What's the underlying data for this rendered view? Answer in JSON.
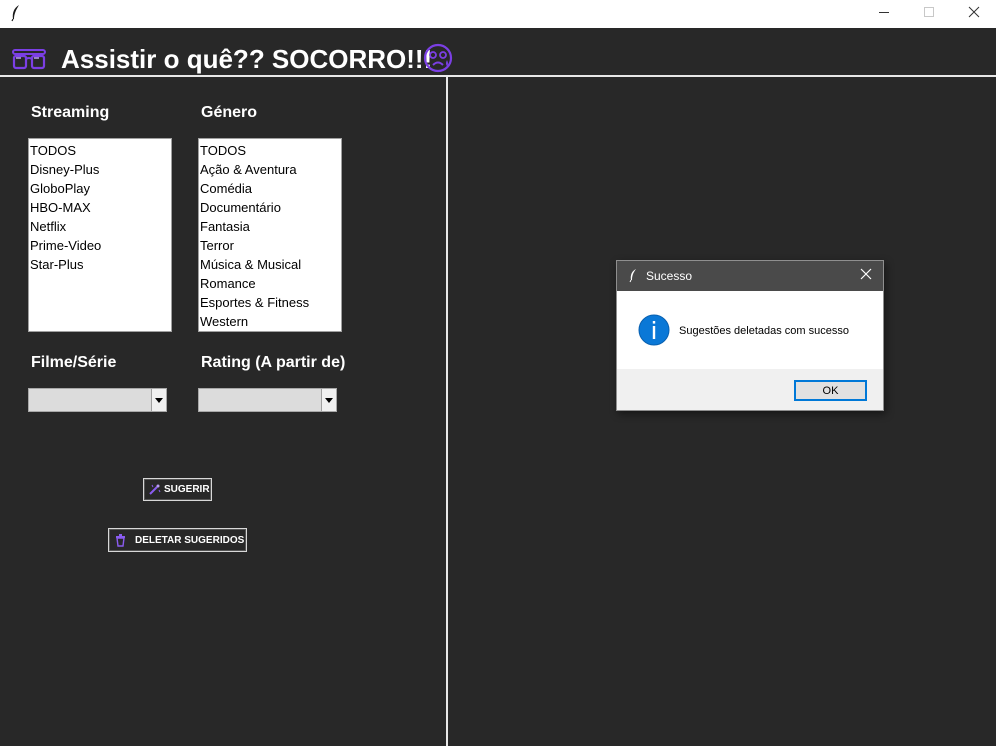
{
  "window": {
    "title": "",
    "controls": [
      "minimize",
      "maximize",
      "close"
    ]
  },
  "header": {
    "title": "Assistir o quê?? SOCORRO!!!",
    "left_icon": "glasses-icon",
    "right_icon": "anxious-face-icon",
    "accent_color": "#7b3fe4"
  },
  "filters": {
    "streaming": {
      "label": "Streaming",
      "options": [
        "TODOS",
        "Disney-Plus",
        "GloboPlay",
        "HBO-MAX",
        "Netflix",
        "Prime-Video",
        "Star-Plus"
      ]
    },
    "genero": {
      "label": "Género",
      "options": [
        "TODOS",
        "Ação & Aventura",
        "Comédia",
        "Documentário",
        "Fantasia",
        "Terror",
        "Música & Musical",
        "Romance",
        "Esportes & Fitness",
        "Western"
      ]
    },
    "filme_serie": {
      "label": "Filme/Série",
      "value": ""
    },
    "rating": {
      "label": "Rating (A partir de)",
      "value": ""
    }
  },
  "actions": {
    "sugerir_label": "SUGERIR",
    "deletar_label": "DELETAR SUGERIDOS"
  },
  "dialog": {
    "title": "Sucesso",
    "message": "Sugestões deletadas com sucesso",
    "ok_label": "OK",
    "info_color": "#0a78d7"
  }
}
